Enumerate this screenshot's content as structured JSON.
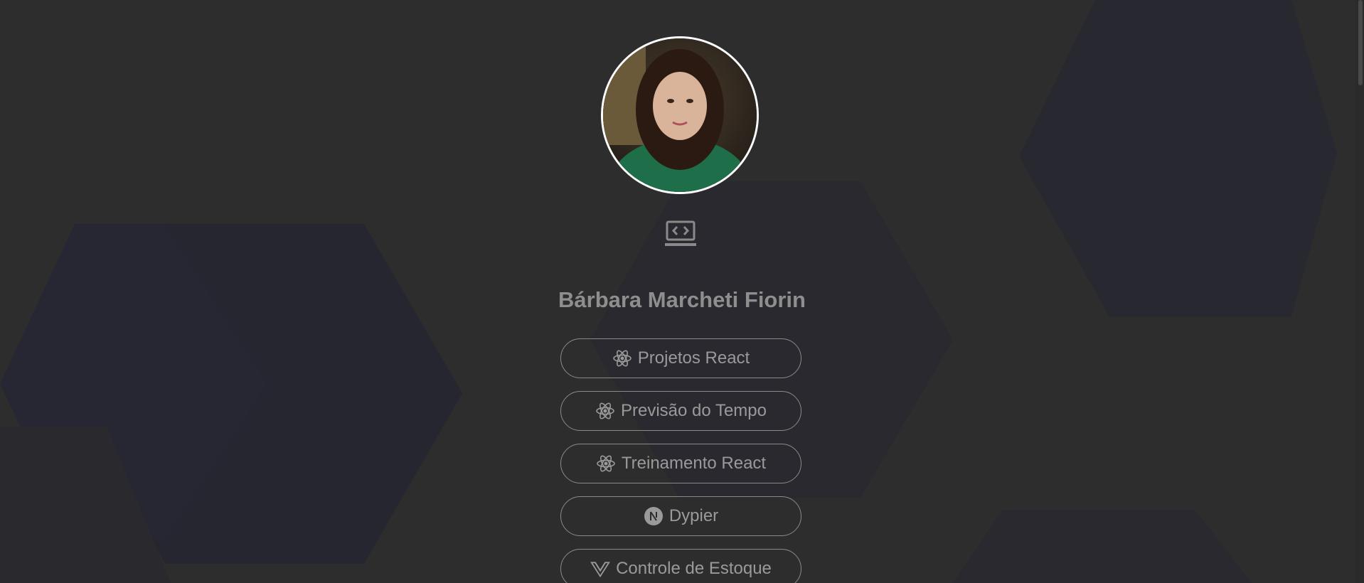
{
  "profile": {
    "name": "Bárbara Marcheti Fiorin",
    "avatar_alt": "profile photo"
  },
  "icons": {
    "header": "laptop-code-icon"
  },
  "links": [
    {
      "label": "Projetos React",
      "icon": "react-icon"
    },
    {
      "label": "Previsão do Tempo",
      "icon": "react-icon"
    },
    {
      "label": "Treinamento React",
      "icon": "react-icon"
    },
    {
      "label": "Dypier",
      "icon": "nextjs-icon"
    },
    {
      "label": "Controle de Estoque",
      "icon": "vue-icon"
    }
  ],
  "colors": {
    "background": "#2d2d2d",
    "hexagon": "#27272f",
    "text": "#9a9a9a",
    "border": "#8a8a8a"
  }
}
